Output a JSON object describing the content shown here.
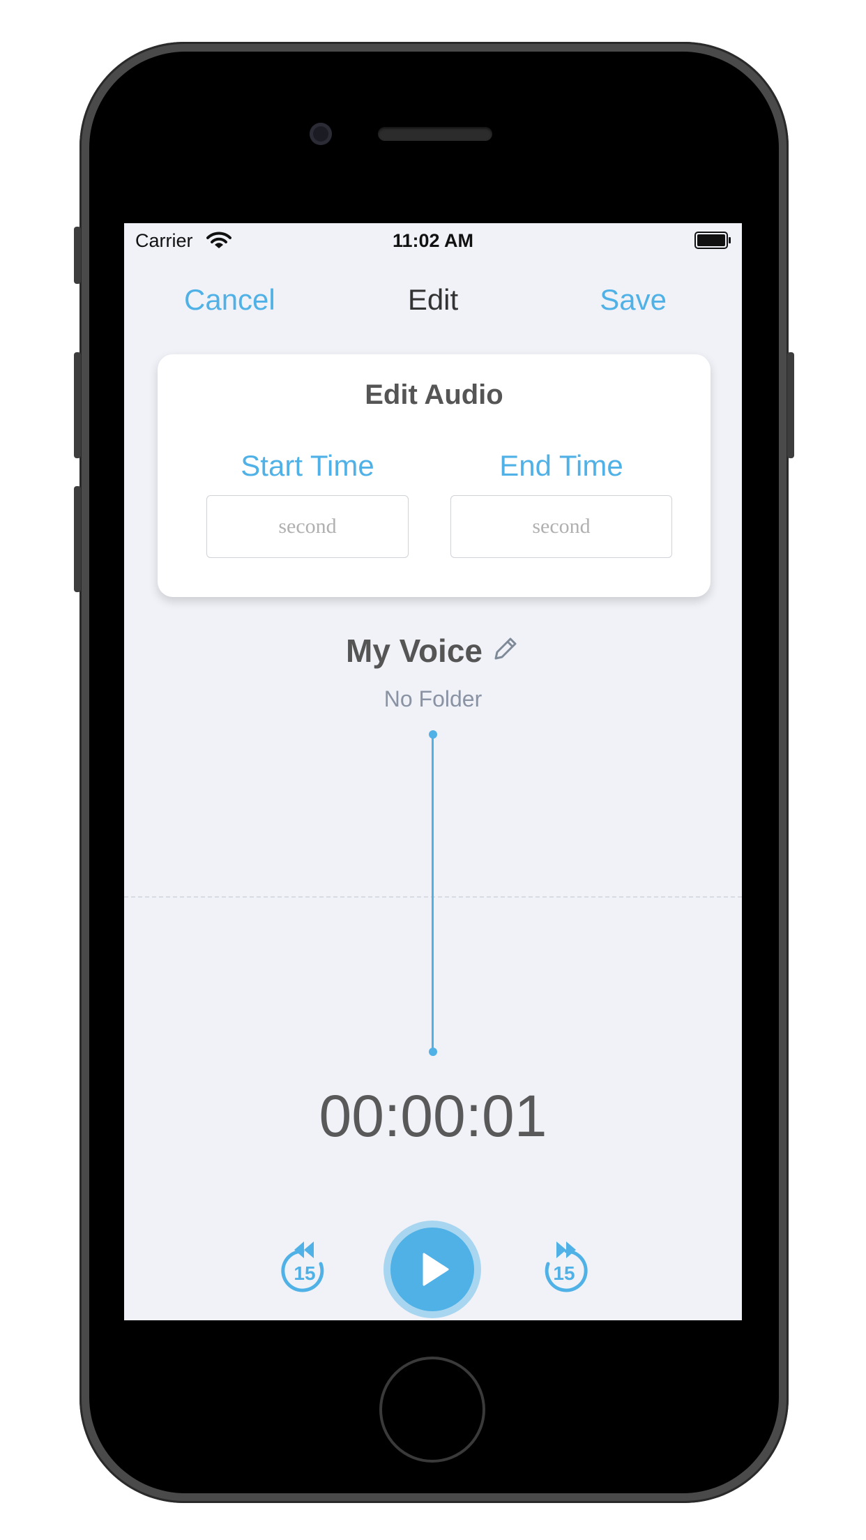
{
  "status_bar": {
    "carrier": "Carrier",
    "time": "11:02 AM"
  },
  "nav": {
    "cancel_label": "Cancel",
    "title": "Edit",
    "save_label": "Save"
  },
  "edit_card": {
    "heading": "Edit Audio",
    "start_label": "Start Time",
    "end_label": "End Time",
    "start_placeholder": "second",
    "end_placeholder": "second"
  },
  "recording": {
    "name": "My Voice",
    "folder": "No Folder",
    "elapsed": "00:00:01"
  },
  "controls": {
    "skip_back_seconds": "15",
    "skip_forward_seconds": "15"
  },
  "colors": {
    "accent": "#4fb1e6",
    "background": "#f0f2f8"
  }
}
